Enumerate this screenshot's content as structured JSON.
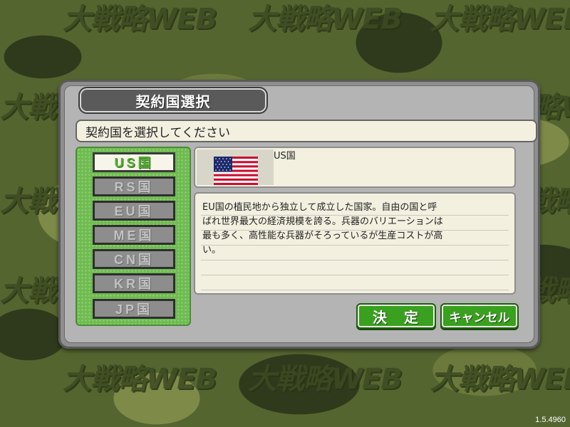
{
  "background": {
    "watermark_text": "大戦略WEB",
    "colors": {
      "camo_dark": "#2f3a1c",
      "camo_mid": "#55652f",
      "camo_light": "#7e8a48"
    }
  },
  "version": "1.5.4960",
  "dialog": {
    "title": "契約国選択",
    "prompt": "契約国を選択してください",
    "countries": [
      {
        "label": "US国",
        "selected": true
      },
      {
        "label": "RS国",
        "selected": false
      },
      {
        "label": "EU国",
        "selected": false
      },
      {
        "label": "ME国",
        "selected": false
      },
      {
        "label": "CN国",
        "selected": false
      },
      {
        "label": "KR国",
        "selected": false
      },
      {
        "label": "JP国",
        "selected": false
      }
    ],
    "selected_country": {
      "name": "US国",
      "flag": "us-flag",
      "description": "EU国の植民地から独立して成立した国家。自由の国と呼\nばれ世界最大の経済規模を誇る。兵器のバリエーションは\n最も多く、高性能な兵器がそろっているが生産コストが高\nい。"
    },
    "buttons": {
      "ok": "決　定",
      "cancel": "キャンセル"
    },
    "colors": {
      "accent_green": "#3aa020",
      "panel_green": "#6fbb52"
    }
  }
}
